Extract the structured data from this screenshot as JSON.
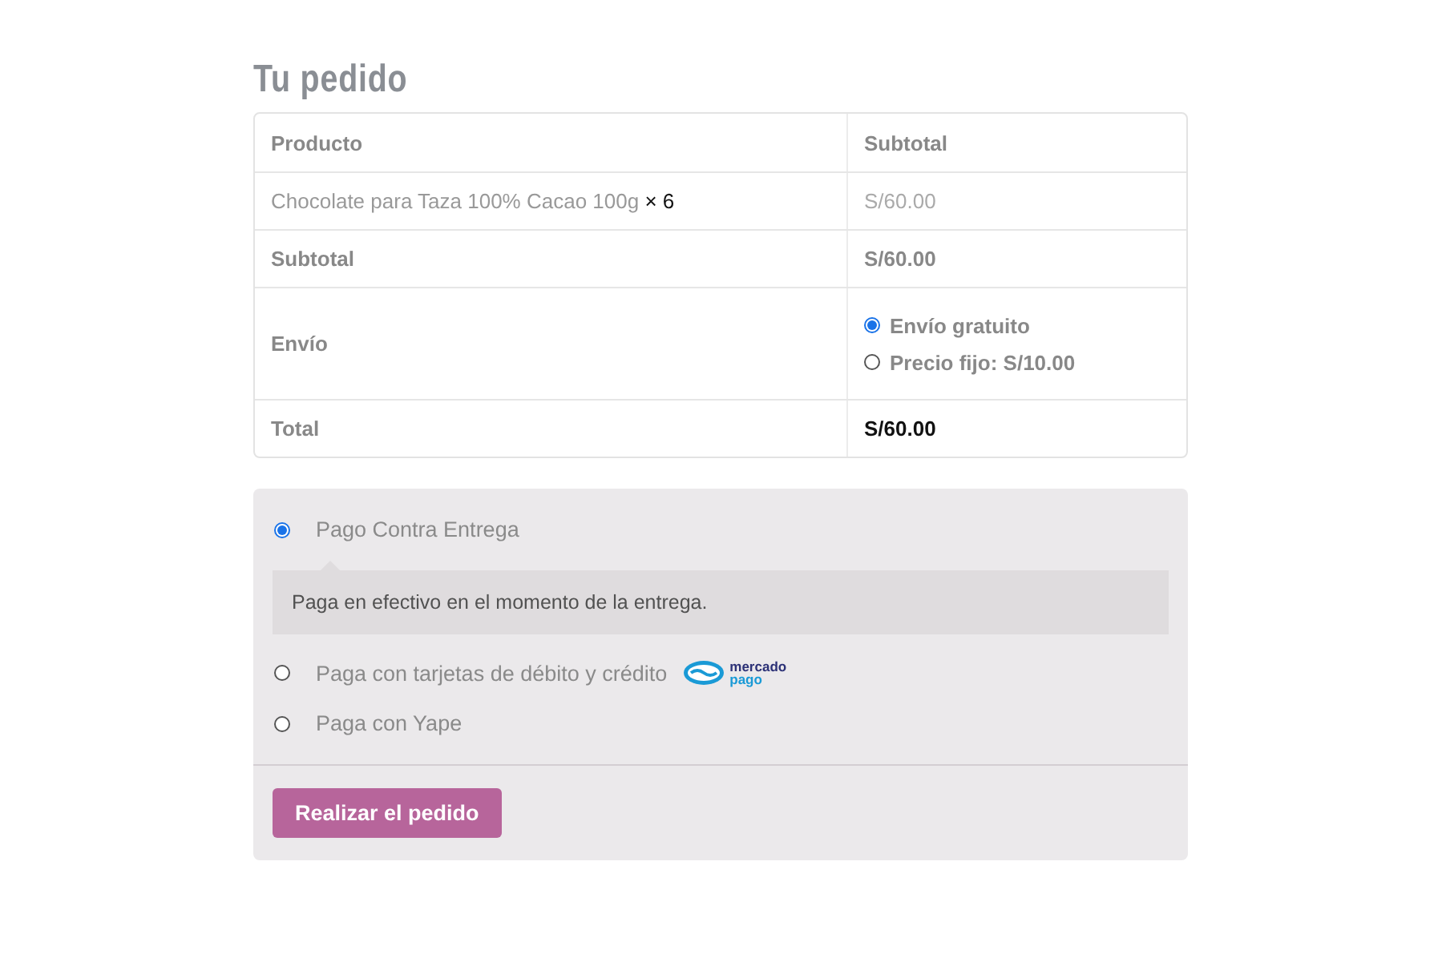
{
  "title": "Tu pedido",
  "table": {
    "columns": [
      "Producto",
      "Subtotal"
    ],
    "product": {
      "name": "Chocolate para Taza 100% Cacao 100g",
      "quantity": "× 6",
      "subtotal": "S/60.00"
    },
    "subtotal": {
      "label": "Subtotal",
      "value": "S/60.00"
    },
    "shipping": {
      "label": "Envío",
      "options": [
        {
          "label": "Envío gratuito",
          "selected": true
        },
        {
          "label": "Precio fijo: S/10.00",
          "selected": false
        }
      ]
    },
    "total": {
      "label": "Total",
      "value": "S/60.00"
    }
  },
  "payment": {
    "methods": [
      {
        "label": "Pago Contra Entrega",
        "selected": true,
        "description": "Paga en efectivo en el momento de la entrega."
      },
      {
        "label": "Paga con tarjetas de débito y crédito",
        "selected": false,
        "logo": {
          "line1": "mercado",
          "line2": "pago"
        }
      },
      {
        "label": "Paga con Yape",
        "selected": false
      }
    ],
    "button": "Realizar el pedido"
  }
}
